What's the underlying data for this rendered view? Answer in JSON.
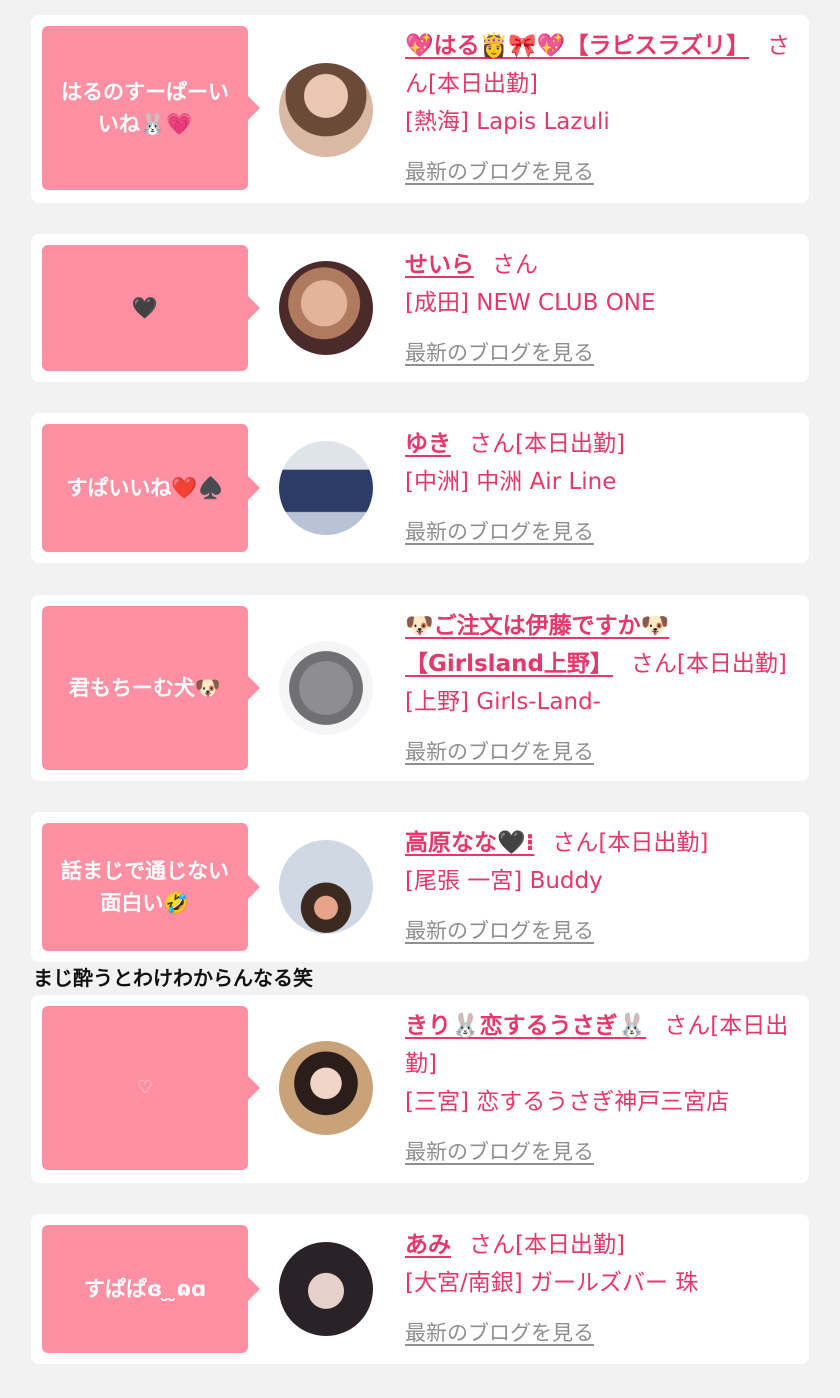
{
  "entries": [
    {
      "bubble": "はるのすーぱーいいね🐰💗",
      "name": "💖はる👸🎀💖【ラピスラズリ】",
      "suffix": "さん[本日出勤]",
      "shop": "[熱海] Lapis Lazuli",
      "blog": "最新のブログを見る",
      "avatar_colors": [
        "#d9b8a4",
        "#6b4a3a"
      ]
    },
    {
      "bubble": "🖤",
      "name": "せいら",
      "suffix": "さん",
      "shop": "[成田] NEW CLUB ONE",
      "blog": "最新のブログを見る",
      "avatar_colors": [
        "#e3b49a",
        "#4b2a2a"
      ]
    },
    {
      "bubble": "すぱいいね❤️♠️",
      "name": "ゆき",
      "suffix": "さん[本日出勤]",
      "shop": "[中洲] 中洲 Air Line",
      "blog": "最新のブログを見る",
      "avatar_colors": [
        "#2d3c66",
        "#b9c3d6"
      ]
    },
    {
      "bubble": "君もちーむ犬🐶",
      "name": "🐶ご注文は伊藤ですか🐶【Girlsland上野】",
      "suffix": "さん[本日出勤]",
      "shop": "[上野] Girls-Land-",
      "blog": "最新のブログを見る",
      "avatar_colors": [
        "#8e8e92",
        "#f5f5f5"
      ]
    },
    {
      "bubble": "話まじで通じない面白い🤣",
      "name": "高原なな🖤⁝",
      "suffix": "さん[本日出勤]",
      "shop": "[尾張 一宮] Buddy",
      "blog": "最新のブログを見る",
      "avatar_colors": [
        "#cfd8e3",
        "#3a2a20"
      ]
    },
    {
      "bubble": "♡",
      "name": "きり🐰恋するうさぎ🐰",
      "suffix": "さん[本日出勤]",
      "shop": "[三宮] 恋するうさぎ神戸三宮店",
      "blog": "最新のブログを見る",
      "avatar_colors": [
        "#c9a27a",
        "#2a1e1a"
      ]
    },
    {
      "bubble": "すぱぱɞ ̮ ̮ɷɑ",
      "name": "あみ",
      "suffix": "さん[本日出勤]",
      "shop": "[大宮/南銀] ガールズバー 珠",
      "blog": "最新のブログを見る",
      "avatar_colors": [
        "#2a2226",
        "#e7d2cb"
      ]
    }
  ],
  "comment_text": "まじ酔うとわけわからんなる笑",
  "theme": {
    "accent": "#e8376b",
    "bubble": "#ff8fa3",
    "link_gray": "#8f8f8f"
  }
}
